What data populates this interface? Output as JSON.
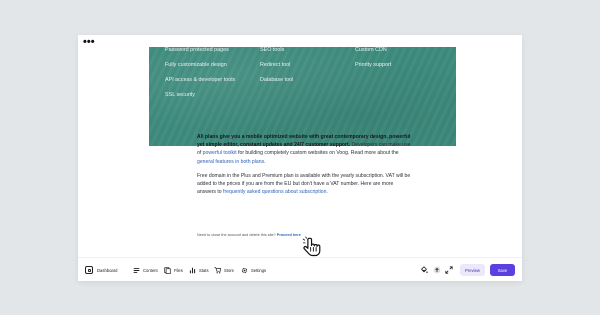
{
  "window": {
    "controls_label": "•••"
  },
  "features": {
    "col1": [
      "Password protected pages",
      "Fully customizable design",
      "API access & developer tools",
      "SSL security"
    ],
    "col2": [
      "SEO tools",
      "Redirect tool",
      "Database tool"
    ],
    "col3": [
      "Custom CDN",
      "Priority support"
    ]
  },
  "info": {
    "p1_bold": "All plans give you a mobile optimized website with great contemporary design, powerful yet simple editor, constant updates and 24/7 customer support.",
    "p1_a": " Developers can make use of ",
    "p1_link1": "powerful toolkit",
    "p1_b": " for building completely custom websites on Voog. Read more about the ",
    "p1_link2": "general features in both plans",
    "p1_c": ".",
    "p2_a": "Free domain in the Plus and Premium plan is available with the yearly subscription. VAT will be added to the prices if you are from the EU but don't have a VAT number. Here are more answers to ",
    "p2_link": "frequently asked questions about subscription",
    "p2_c": ".",
    "close_text": "Need to close the account and delete this site? ",
    "close_link": "Proceed here"
  },
  "toolbar": {
    "dashboard": "Dashboard",
    "content": "Content",
    "files": "Files",
    "stats": "Stats",
    "store": "Store",
    "settings": "Settings",
    "preview": "Preview",
    "save": "Save"
  },
  "colors": {
    "hero": "#3d8b7d",
    "accent": "#5b3fe0",
    "link": "#2f5fb7"
  }
}
